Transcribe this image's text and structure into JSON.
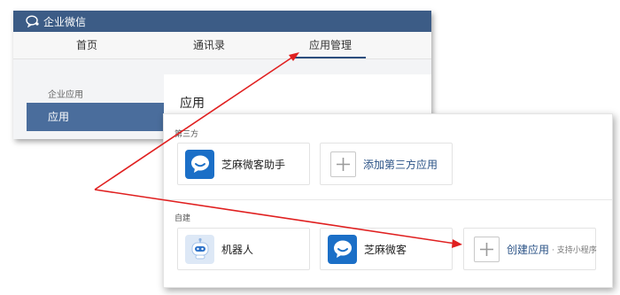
{
  "app": {
    "title": "企业微信"
  },
  "nav": {
    "tabs": [
      "首页",
      "通讯录",
      "应用管理"
    ],
    "active_index": 2
  },
  "sidebar": {
    "group_label": "企业应用",
    "active_item": "应用"
  },
  "page": {
    "title": "应用"
  },
  "sections": {
    "third_party": {
      "label": "第三方",
      "cards": [
        {
          "label": "芝麻微客助手",
          "icon": "chat-bubble-icon"
        },
        {
          "label": "添加第三方应用",
          "icon": "plus-icon"
        }
      ]
    },
    "self_built": {
      "label": "自建",
      "cards": [
        {
          "label": "机器人",
          "icon": "robot-icon"
        },
        {
          "label": "芝麻微客",
          "icon": "chat-bubble-icon"
        },
        {
          "label": "创建应用",
          "sublabel": "· 支持小程序",
          "icon": "plus-icon"
        }
      ]
    }
  },
  "colors": {
    "titlebar": "#3c5c86",
    "sidebar_active": "#4a6d9c",
    "app_icon_blue": "#1b6fc7",
    "annotation_arrow": "#e02020"
  }
}
